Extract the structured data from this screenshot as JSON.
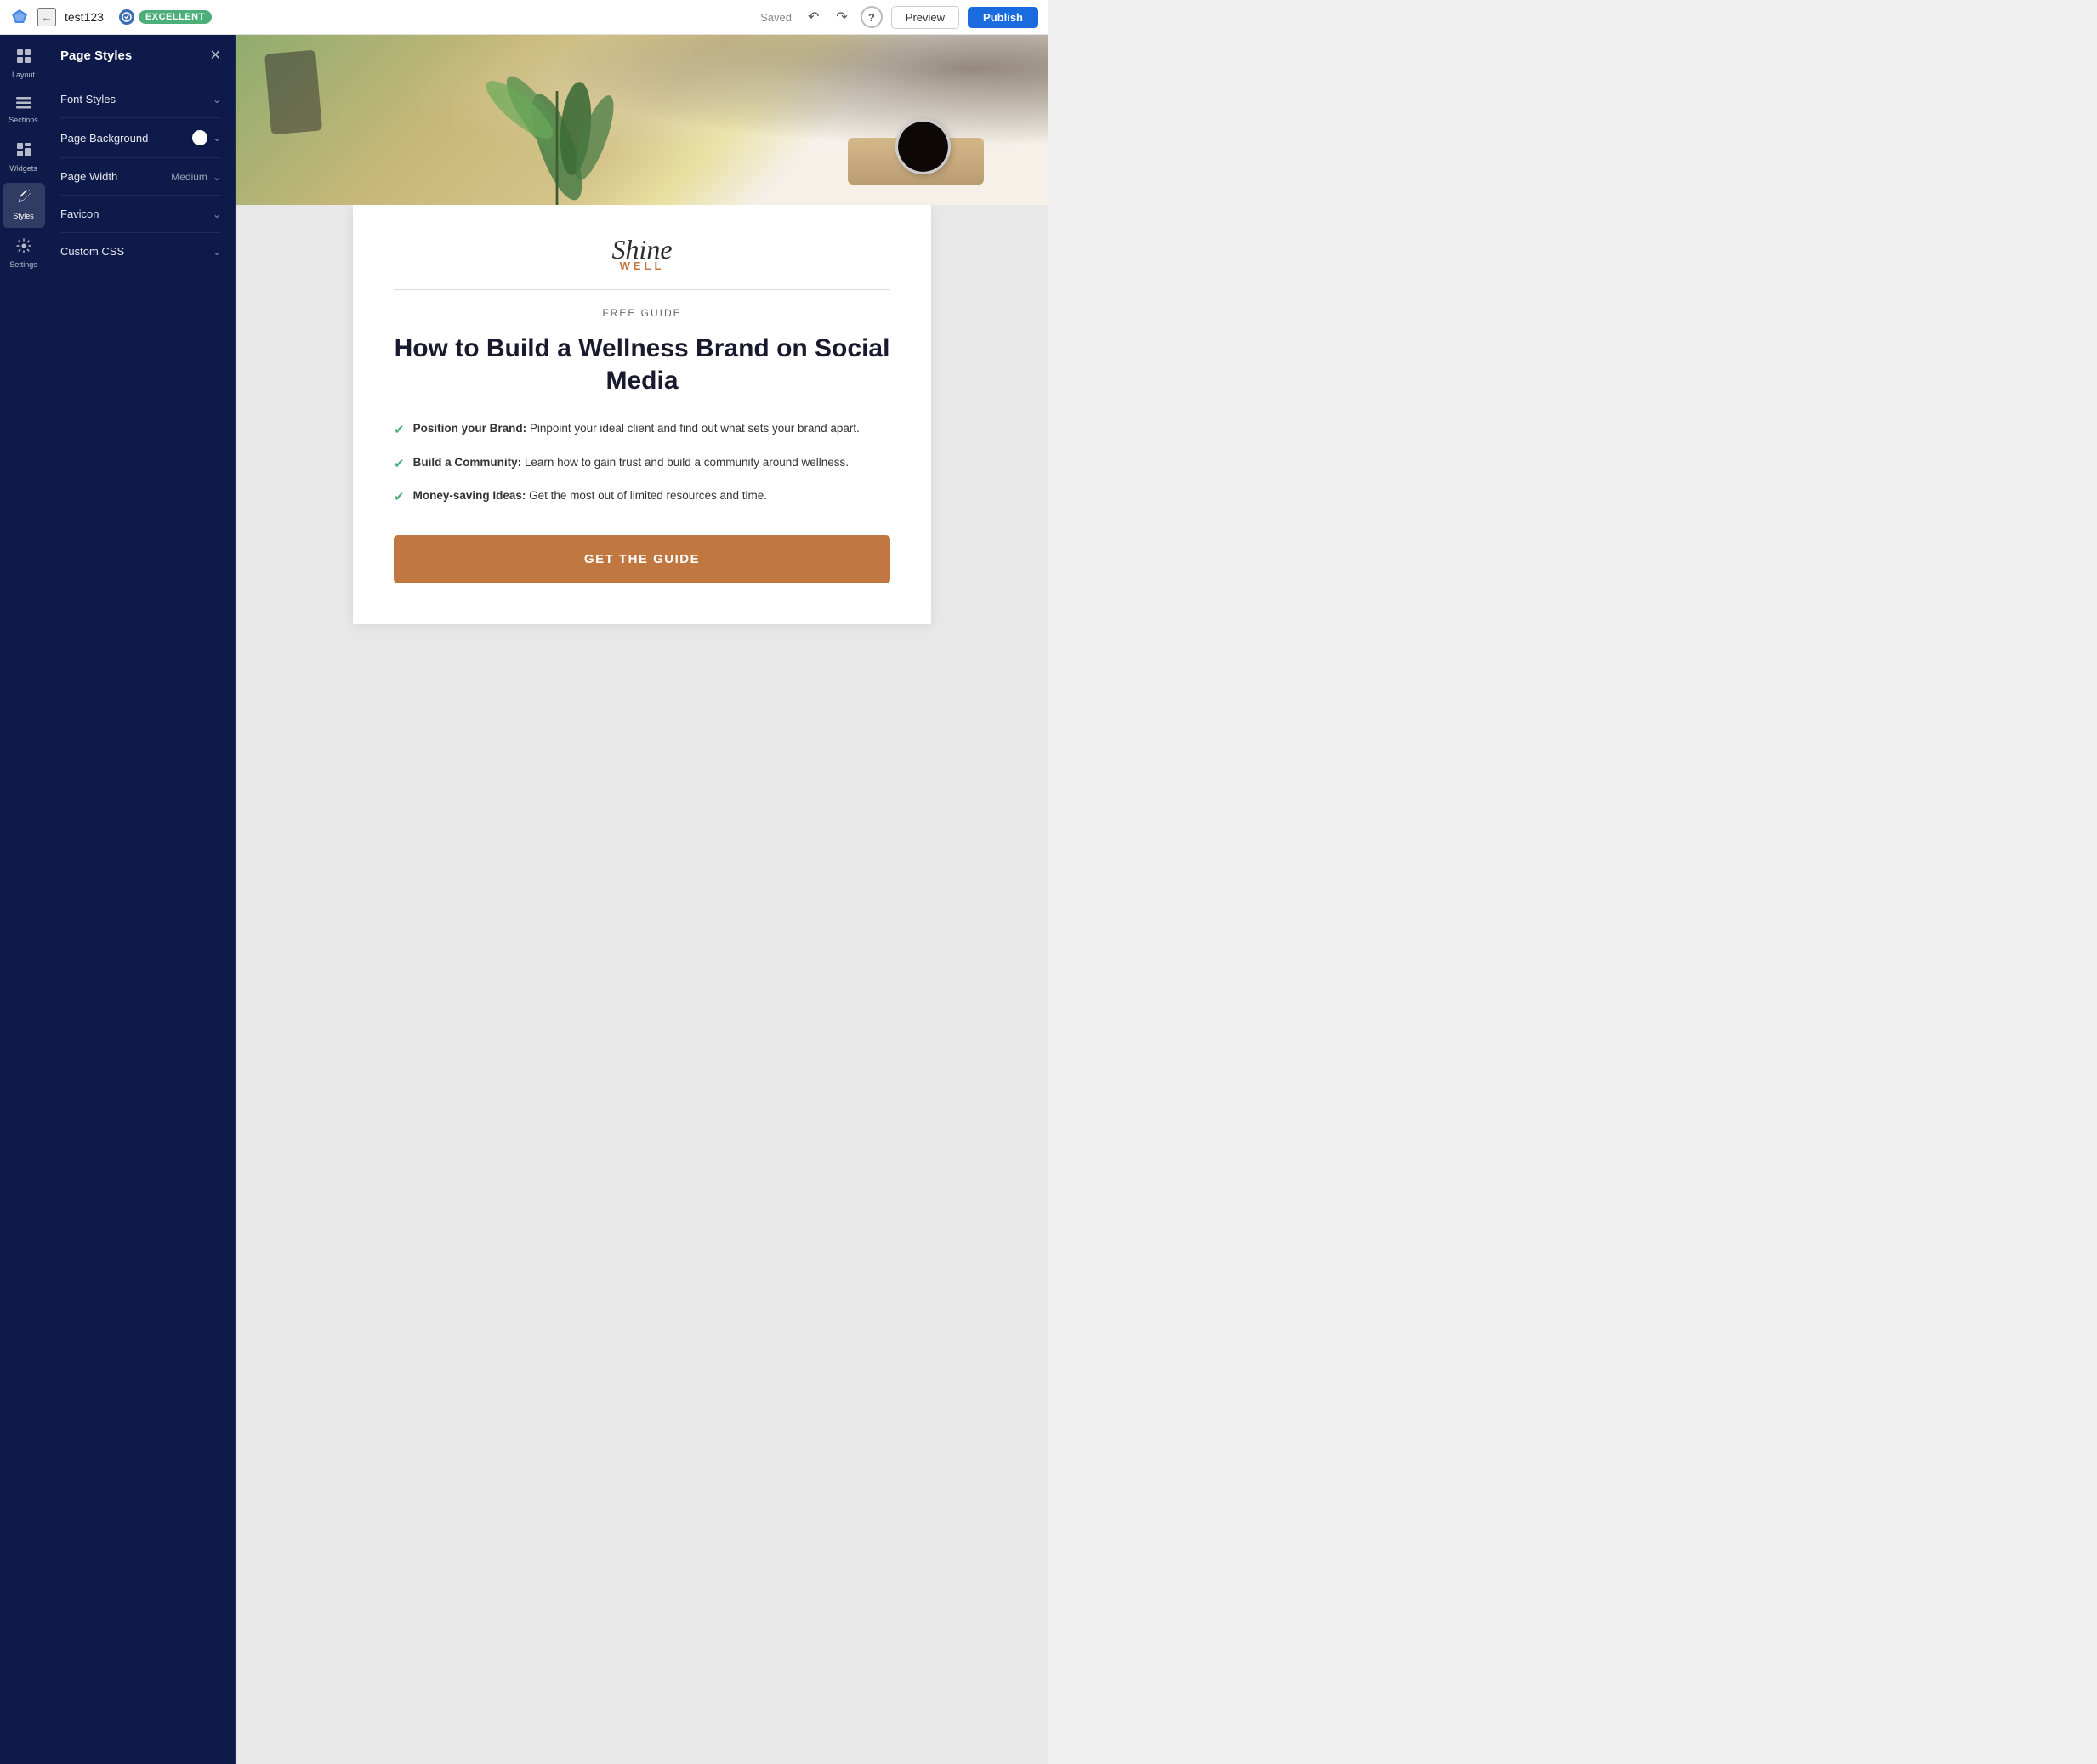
{
  "topbar": {
    "title": "test123",
    "badge": "EXCELLENT",
    "saved": "Saved",
    "preview_label": "Preview",
    "publish_label": "Publish"
  },
  "sidebar": {
    "items": [
      {
        "id": "layout",
        "label": "Layout",
        "icon": "⊞"
      },
      {
        "id": "sections",
        "label": "Sections",
        "icon": "☰"
      },
      {
        "id": "widgets",
        "label": "Widgets",
        "icon": "⊡"
      },
      {
        "id": "styles",
        "label": "Styles",
        "icon": "✏️",
        "active": true
      },
      {
        "id": "settings",
        "label": "Settings",
        "icon": "⚙"
      }
    ]
  },
  "panel": {
    "title": "Page Styles",
    "rows": [
      {
        "id": "font-styles",
        "label": "Font Styles",
        "value": "",
        "has_toggle": false
      },
      {
        "id": "page-background",
        "label": "Page Background",
        "value": "",
        "has_toggle": true
      },
      {
        "id": "page-width",
        "label": "Page Width",
        "value": "Medium",
        "has_toggle": false
      },
      {
        "id": "favicon",
        "label": "Favicon",
        "value": "",
        "has_toggle": false
      },
      {
        "id": "custom-css",
        "label": "Custom CSS",
        "value": "",
        "has_toggle": false
      }
    ]
  },
  "canvas": {
    "logo": {
      "shine": "Shine",
      "well": "WELL"
    },
    "free_guide": "FREE GUIDE",
    "heading": "How to Build a Wellness Brand on Social Media",
    "bullets": [
      {
        "bold": "Position your Brand:",
        "text": " Pinpoint your ideal client and find out what sets your brand apart."
      },
      {
        "bold": "Build a Community:",
        "text": " Learn how to gain trust and build a community around wellness."
      },
      {
        "bold": "Money-saving Ideas:",
        "text": " Get the most out of limited resources and time."
      }
    ],
    "cta_label": "GET THE GUIDE"
  }
}
